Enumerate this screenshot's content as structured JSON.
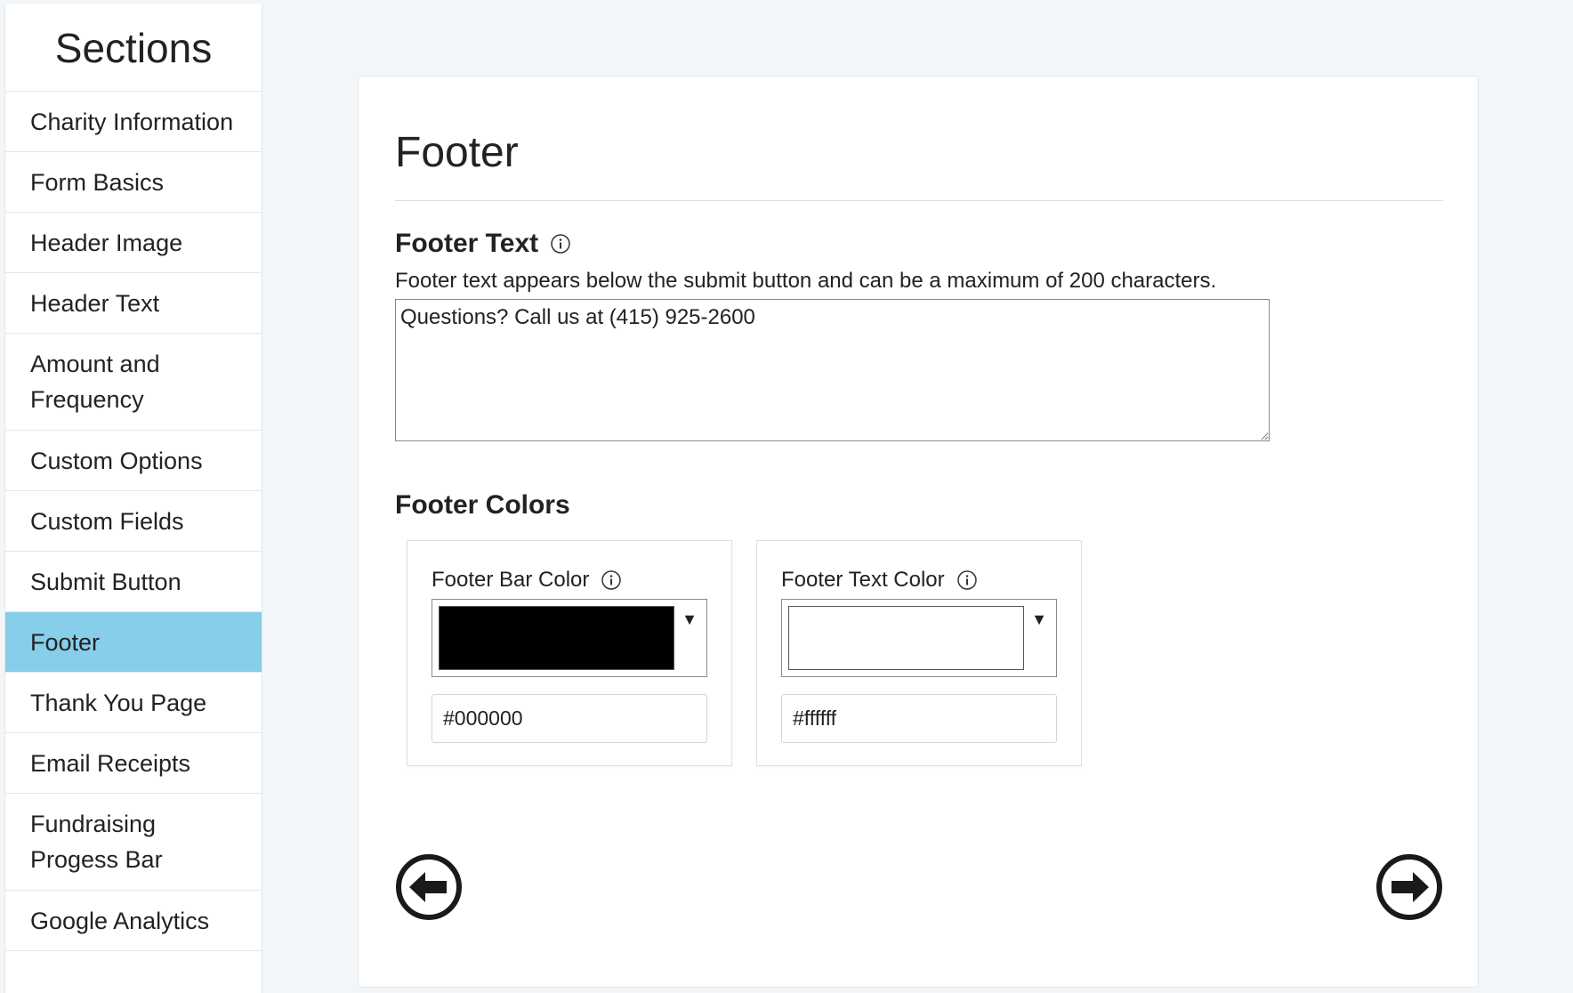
{
  "sidebar": {
    "title": "Sections",
    "items": [
      {
        "label": "Charity Information",
        "active": false,
        "tall": false
      },
      {
        "label": "Form Basics",
        "active": false,
        "tall": false
      },
      {
        "label": "Header Image",
        "active": false,
        "tall": false
      },
      {
        "label": "Header Text",
        "active": false,
        "tall": false
      },
      {
        "label": "Amount and Frequency",
        "active": false,
        "tall": true
      },
      {
        "label": "Custom Options",
        "active": false,
        "tall": false
      },
      {
        "label": "Custom Fields",
        "active": false,
        "tall": false
      },
      {
        "label": "Submit Button",
        "active": false,
        "tall": false
      },
      {
        "label": "Footer",
        "active": true,
        "tall": false
      },
      {
        "label": "Thank You Page",
        "active": false,
        "tall": false
      },
      {
        "label": "Email Receipts",
        "active": false,
        "tall": false
      },
      {
        "label": "Fundraising Progess Bar",
        "active": false,
        "tall": true
      },
      {
        "label": "Google Analytics",
        "active": false,
        "tall": false
      }
    ],
    "active_color": "#87ceeb"
  },
  "main": {
    "title": "Footer",
    "footer_text": {
      "heading": "Footer Text",
      "help": "Footer text appears below the submit button and can be a maximum of 200 characters.",
      "value": "Questions? Call us at (415) 925-2600"
    },
    "footer_colors": {
      "heading": "Footer Colors",
      "bar_color": {
        "label": "Footer Bar Color",
        "swatch": "#000000",
        "hex": "#000000"
      },
      "text_color": {
        "label": "Footer Text Color",
        "swatch": "#ffffff",
        "hex": "#ffffff"
      }
    },
    "nav": {
      "prev_icon": "arrow-left-circle-icon",
      "next_icon": "arrow-right-circle-icon"
    }
  }
}
